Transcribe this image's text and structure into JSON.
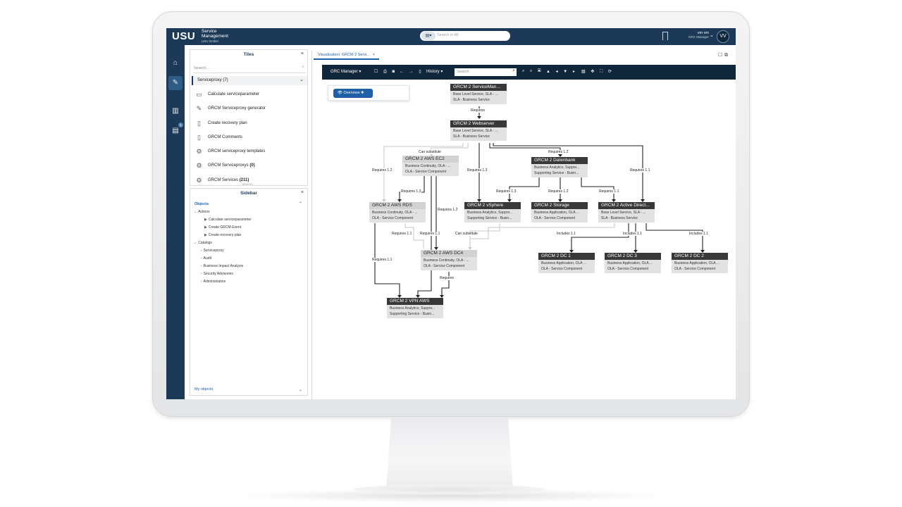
{
  "topbar": {
    "logo": "USU",
    "brand_line1": "Service",
    "brand_line2": "Management",
    "brand_line3": "USU GmbH",
    "search_placeholder": "Search in All",
    "user_name": "vm vm",
    "user_role": "GRC Manager",
    "avatar_initials": "VV"
  },
  "rail": {
    "items": [
      "home",
      "edit",
      "book",
      "news"
    ],
    "badge": "1"
  },
  "tiles": {
    "title": "Tiles",
    "search_placeholder": "Search...",
    "group_label": "Serviceproxy (7)",
    "items": [
      {
        "label": "Calculate serviceparameter",
        "count": ""
      },
      {
        "label": "GRCM Serviceproxy generator",
        "count": ""
      },
      {
        "label": "Create recovery plan",
        "count": ""
      },
      {
        "label": "GRCM Comments",
        "count": ""
      },
      {
        "label": "GRCM serviceproxy templates",
        "count": ""
      },
      {
        "label": "GRCM Serviceproxys",
        "count": "(0)"
      },
      {
        "label": "GRCM Services",
        "count": "(211)"
      }
    ]
  },
  "sidebar": {
    "title": "Sidebar",
    "objects_label": "Objects",
    "actions_label": "Actions",
    "actions": [
      "Calculate serviceparameter",
      "Create GRCM-Event",
      "Create recovery plan"
    ],
    "catalogs_label": "Catalogs",
    "catalogs": [
      "Serviceproxy",
      "Audit",
      "Business Impact Analysis",
      "Security Advisories",
      "Administration"
    ],
    "my_objects_label": "My objects"
  },
  "main": {
    "tab_label": "Visualization: GRCM 2 Servi...",
    "toolbar": {
      "manager_label": "GRC Manager",
      "history_label": "History",
      "search_placeholder": "Search"
    },
    "overview_label": "Overview"
  },
  "diagram": {
    "nodes": [
      {
        "id": "servicemanager",
        "title": "GRCM 2 ServiceMan...",
        "l1": "Base Level Service, SLA - ...",
        "l2": "SLA - Business Service"
      },
      {
        "id": "webserver",
        "title": "GRCM 2 Webserver",
        "l1": "Base Level Service, SLA - ...",
        "l2": "SLA - Business Service"
      },
      {
        "id": "ec2",
        "title": "GRCM 2 AWS EC2",
        "l1": "Business Continuity, OLA - ...",
        "l2": "OLA - Service Component"
      },
      {
        "id": "datenbank",
        "title": "GRCM 2 Datenbank",
        "l1": "Business Analytics, Suppor...",
        "l2": "Supporting Service - Busin..."
      },
      {
        "id": "rds",
        "title": "GRCM 2 AWS RDS",
        "l1": "Business Continuity, OLA - ...",
        "l2": "OLA - Service Component"
      },
      {
        "id": "vsphere",
        "title": "GRCM 2 vSphere",
        "l1": "Business Analytics, Suppor...",
        "l2": "Supporting Service - Busin..."
      },
      {
        "id": "storage",
        "title": "GRCM 2 Storage",
        "l1": "Business Application, OLA ...",
        "l2": "OLA - Service Component"
      },
      {
        "id": "activedirectory",
        "title": "GRCM 2 Active Direct...",
        "l1": "Base Level Service, SLA - ...",
        "l2": "SLA - Business Service"
      },
      {
        "id": "dc4",
        "title": "GRCM 2 AWS DC4",
        "l1": "Business Continuity, OLA - ...",
        "l2": "OLA - Service Component"
      },
      {
        "id": "dc1",
        "title": "GRCM 2 DC 1",
        "l1": "Business Application, OLA ...",
        "l2": "OLA - Service Component"
      },
      {
        "id": "dc3",
        "title": "GRCM 2 DC 3",
        "l1": "Business Application, OLA ...",
        "l2": "OLA - Service Component"
      },
      {
        "id": "dc2",
        "title": "GRCM 2 DC 2",
        "l1": "Business Application, OLA ...",
        "l2": "OLA - Service Component"
      },
      {
        "id": "vpn",
        "title": "GRCM 2 VPN AWS",
        "l1": "Business Analytics, Suppor...",
        "l2": "Supporting Service - Busin..."
      }
    ],
    "edge_labels": {
      "sm_web": "Requires",
      "web_ec2": "Can substitute",
      "web_rds": "Requires 1.2",
      "web_vsphere": "Requires 1.3",
      "web_db": "Requires 1.2",
      "web_ad": "Requires 1.1",
      "ec2_rds": "Requires 1.3",
      "ec2_dc4": "Requires 1.2",
      "db_vsphere": "Requires 1.3",
      "db_storage": "Requires 1.2",
      "db_ad": "Requires 1.1",
      "rds_dc4": "Requires 1.1",
      "ec2_vpn": "Requires 1.1",
      "vsphere_dc4": "Can substitute",
      "rds_vpn": "Requires 1.1",
      "ad_dc1": "Includes 1.1",
      "ad_dc3": "Includes 1.1",
      "ad_dc2": "Includes 1.1",
      "dc4_vpn": "Requires"
    }
  }
}
